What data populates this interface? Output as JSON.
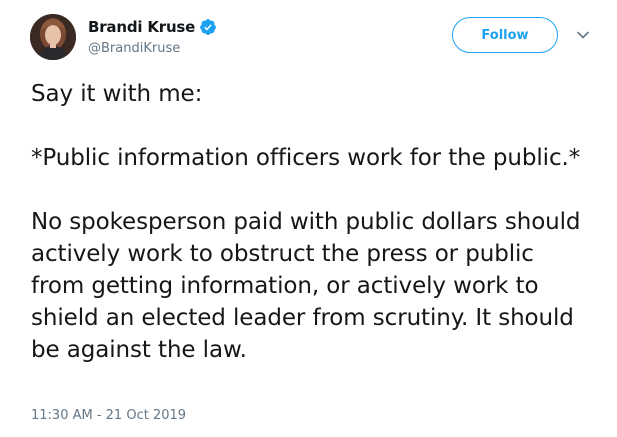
{
  "author": {
    "display_name": "Brandi Kruse",
    "handle": "@BrandiKruse",
    "verified": true,
    "avatar_icon": "profile-photo"
  },
  "actions": {
    "follow_label": "Follow",
    "menu_icon": "chevron-down-icon"
  },
  "tweet": {
    "text": "Say it with me:\n\n*Public information officers work for the public.*\n\nNo spokesperson paid with public dollars should actively work to obstruct the press or public from getting information, or actively work to shield an elected leader from scrutiny. It should be against the law.",
    "timestamp": "11:30 AM - 21 Oct 2019"
  },
  "colors": {
    "accent": "#1da1f2",
    "text": "#14171a",
    "secondary": "#657786"
  }
}
